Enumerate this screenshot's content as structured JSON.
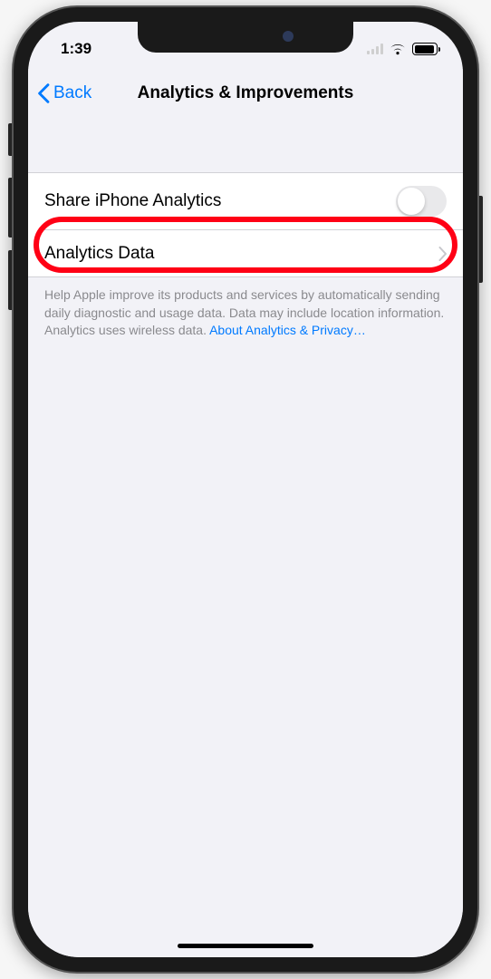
{
  "status": {
    "time": "1:39"
  },
  "nav": {
    "back_label": "Back",
    "title": "Analytics & Improvements"
  },
  "rows": {
    "share_analytics_label": "Share iPhone Analytics",
    "analytics_data_label": "Analytics Data"
  },
  "footer": {
    "text": "Help Apple improve its products and services by automatically sending daily diagnostic and usage data. Data may include location information. Analytics uses wireless data. ",
    "link_text": "About Analytics & Privacy…"
  }
}
